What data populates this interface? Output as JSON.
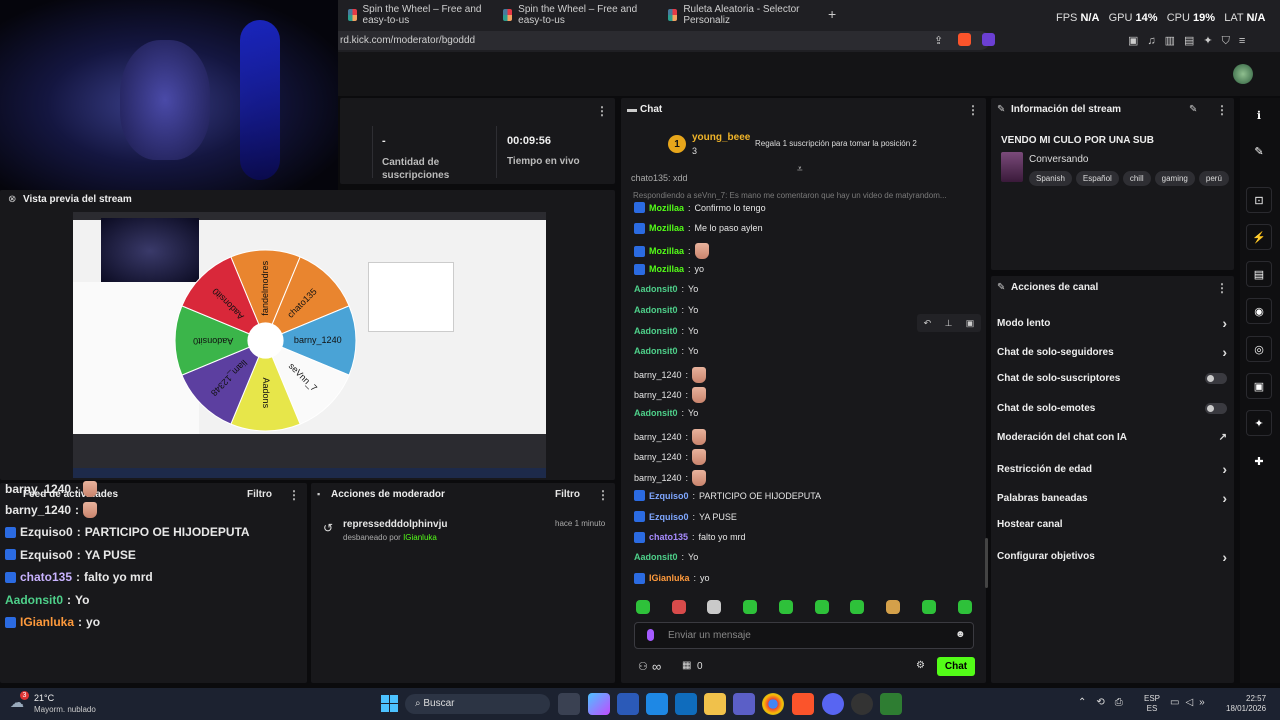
{
  "browser": {
    "tabs": [
      {
        "label": "Spin the Wheel – Free and easy-to-us"
      },
      {
        "label": "Spin the Wheel – Free and easy-to-us"
      },
      {
        "label": "Ruleta Aleatoria - Selector Personaliz"
      }
    ],
    "new_tab": "+",
    "url": "rd.kick.com/moderator/bgoddd",
    "overlay": {
      "fps_label": "FPS",
      "fps": "N/A",
      "gpu_label": "GPU",
      "gpu": "14%",
      "cpu_label": "CPU",
      "cpu": "19%",
      "lat_label": "LAT",
      "lat": "N/A"
    }
  },
  "stats": {
    "subs_value": "-",
    "subs_label": "Cantidad de suscripciones",
    "time_value": "00:09:56",
    "time_label": "Tiempo en vivo"
  },
  "preview": {
    "title": "Vista previa del stream",
    "wheel_names": [
      "fandelmodres",
      "chato135",
      "barny_1240",
      "seVnn_7",
      "Aadons",
      "liam_12348",
      "Aadonsit0",
      "Aadonsit0"
    ]
  },
  "activity": {
    "title": "Feed de actividades",
    "filter": "Filtro",
    "overlay_lines": [
      {
        "user": "barny_1240",
        "text": "",
        "emote": true
      },
      {
        "user": "barny_1240",
        "text": "",
        "emote": true
      }
    ],
    "lines": [
      {
        "user": "Ezquiso0",
        "text": "PARTICIPO OE HIJODEPUTA",
        "badge": true
      },
      {
        "user": "Ezquiso0",
        "text": "YA PUSE",
        "badge": true
      },
      {
        "user": "chato135",
        "text": "falto yo mrd",
        "badge": true
      },
      {
        "user": "Aadonsit0",
        "text": "Yo",
        "badge": false
      },
      {
        "user": "IGianluka",
        "text": "yo",
        "badge": true
      }
    ]
  },
  "modactions": {
    "title": "Acciones de moderador",
    "filter": "Filtro",
    "item_user": "repressedddolphinvju",
    "item_action": "desbaneado por",
    "item_mod": "IGianluka",
    "item_time": "hace 1 minuto"
  },
  "chat": {
    "title": "Chat",
    "pinned_rank": "1",
    "pinned_user": "young_beee",
    "pinned_count": "3",
    "pinned_cta": "Regala 1 suscripción para tomar la posición 2",
    "reply_context": "Respondiendo a seVnn_7: Es mano me comentaron que hay un video de matyrandom...",
    "cut_line": "chato135: xdd",
    "messages": [
      {
        "user": "Mozillaa",
        "text": "Confirmo lo tengo",
        "cls": "u-green",
        "badge": true
      },
      {
        "user": "Mozillaa",
        "text": "Me lo paso aylen",
        "cls": "u-green",
        "badge": true
      },
      {
        "user": "Mozillaa",
        "text": "",
        "cls": "u-green",
        "badge": true,
        "emote": true
      },
      {
        "user": "Mozillaa",
        "text": "yo",
        "cls": "u-green",
        "badge": true
      },
      {
        "user": "Aadonsit0",
        "text": "Yo",
        "cls": "u-aad",
        "badge": false
      },
      {
        "user": "Aadonsit0",
        "text": "Yo",
        "cls": "u-aad",
        "badge": false
      },
      {
        "user": "Aadonsit0",
        "text": "Yo",
        "cls": "u-aad",
        "badge": false
      },
      {
        "user": "Aadonsit0",
        "text": "Yo",
        "cls": "u-aad",
        "badge": false
      },
      {
        "user": "barny_1240",
        "text": "",
        "cls": "",
        "badge": false,
        "emote": true
      },
      {
        "user": "barny_1240",
        "text": "",
        "cls": "",
        "badge": false,
        "emote": true
      },
      {
        "user": "Aadonsit0",
        "text": "Yo",
        "cls": "u-aad",
        "badge": false
      },
      {
        "user": "barny_1240",
        "text": "",
        "cls": "",
        "badge": false,
        "emote": true
      },
      {
        "user": "barny_1240",
        "text": "",
        "cls": "",
        "badge": false,
        "emote": true
      },
      {
        "user": "barny_1240",
        "text": "",
        "cls": "",
        "badge": false,
        "emote": true
      },
      {
        "user": "Ezquiso0",
        "text": "PARTICIPO OE HIJODEPUTA",
        "cls": "u-blue",
        "badge": true
      },
      {
        "user": "Ezquiso0",
        "text": "YA PUSE",
        "cls": "u-blue",
        "badge": true
      },
      {
        "user": "chato135",
        "text": "falto yo mrd",
        "cls": "u-purple",
        "badge": true
      },
      {
        "user": "Aadonsit0",
        "text": "Yo",
        "cls": "u-aad",
        "badge": false
      },
      {
        "user": "IGianluka",
        "text": "yo",
        "cls": "u-orange",
        "badge": true
      }
    ],
    "input_placeholder": "Enviar un mensaje",
    "infinity": "∞",
    "gift_count": "0",
    "send_label": "Chat"
  },
  "streaminfo": {
    "title": "Información del stream",
    "stream_title": "VENDO MI CULO POR UNA SUB",
    "category": "Conversando",
    "tags": [
      "Spanish",
      "Español",
      "chill",
      "gaming",
      "perú"
    ]
  },
  "actions": {
    "title": "Acciones de canal",
    "items": [
      {
        "label": "Modo lento",
        "type": "chevron"
      },
      {
        "label": "Chat de solo-seguidores",
        "type": "chevron"
      },
      {
        "label": "Chat de solo-suscriptores",
        "type": "toggle"
      },
      {
        "label": "Chat de solo-emotes",
        "type": "toggle"
      },
      {
        "label": "Moderación del chat con IA",
        "type": "external"
      },
      {
        "label": "Restricción de edad",
        "type": "chevron"
      },
      {
        "label": "Palabras baneadas",
        "type": "chevron"
      },
      {
        "label": "Hostear canal",
        "type": "none"
      },
      {
        "label": "Configurar objetivos",
        "type": "chevron"
      }
    ]
  },
  "taskbar": {
    "weather_temp": "21°C",
    "weather_desc": "Mayorm. nublado",
    "weather_badge": "3",
    "search": "Buscar",
    "lang1": "ESP",
    "lang2": "ES",
    "time": "22:57",
    "date": "18/01/2026"
  },
  "colors": {
    "accent": "#53fc18",
    "panel": "#18181b",
    "bg": "#0b0b0d"
  }
}
